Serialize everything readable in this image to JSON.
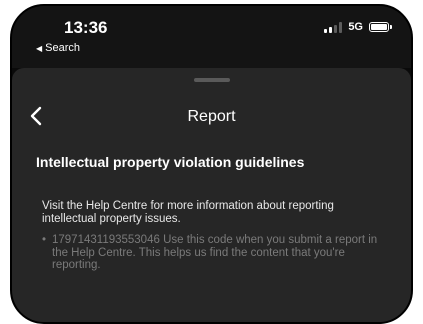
{
  "status_bar": {
    "time": "13:36",
    "back_app": "Search",
    "network": "5G"
  },
  "sheet": {
    "title": "Report",
    "heading": "Intellectual property violation guidelines",
    "description": "Visit the Help Centre for more information about reporting intellectual property issues.",
    "code_item": "17971431193553046 Use this code when you submit a report in the Help Centre. This helps us find the content that you're reporting."
  },
  "icons": {
    "back": "chevron-left-icon",
    "signal": "cellular-signal-icon",
    "battery": "battery-icon"
  }
}
